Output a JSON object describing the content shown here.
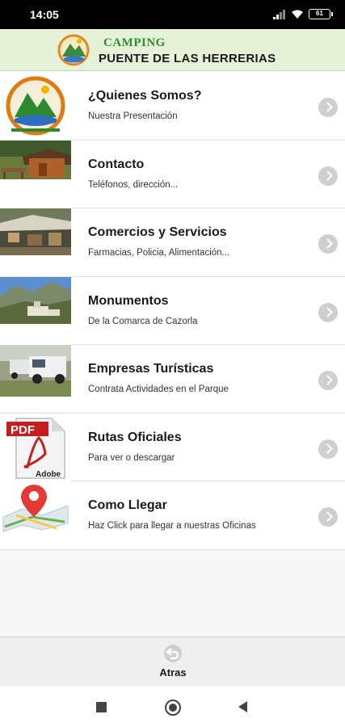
{
  "status_bar": {
    "time": "14:05",
    "battery": "61"
  },
  "header": {
    "brand_line1": "CAMPING",
    "brand_line2": "PUENTE DE LAS HERRERIAS"
  },
  "menu": [
    {
      "title": "¿Quienes Somos?",
      "subtitle": "Nuestra Presentación",
      "thumb": "logo"
    },
    {
      "title": "Contacto",
      "subtitle": "Teléfonos, dirección...",
      "thumb": "cabin-photo"
    },
    {
      "title": "Comercios y Servicios",
      "subtitle": "Farmacias, Policia, Alimentación...",
      "thumb": "terrace-photo"
    },
    {
      "title": "Monumentos",
      "subtitle": "De la Comarca de Cazorla",
      "thumb": "village-photo"
    },
    {
      "title": "Empresas Turísticas",
      "subtitle": "Contrata Actividades en el Parque",
      "thumb": "jeep-photo"
    },
    {
      "title": "Rutas Oficiales",
      "subtitle": "Para ver o descargar",
      "thumb": "pdf-icon"
    },
    {
      "title": "Como Llegar",
      "subtitle": "Haz Click para llegar a nuestras Oficinas",
      "thumb": "map-pin-icon"
    }
  ],
  "pdf_icon_text": {
    "top": "PDF",
    "bottom": "Adobe"
  },
  "bottom_bar": {
    "back_label": "Atras"
  },
  "colors": {
    "header_bg": "#e6f2d8",
    "brand_green": "#2e8b2e",
    "chevron": "#cfcfcf"
  }
}
